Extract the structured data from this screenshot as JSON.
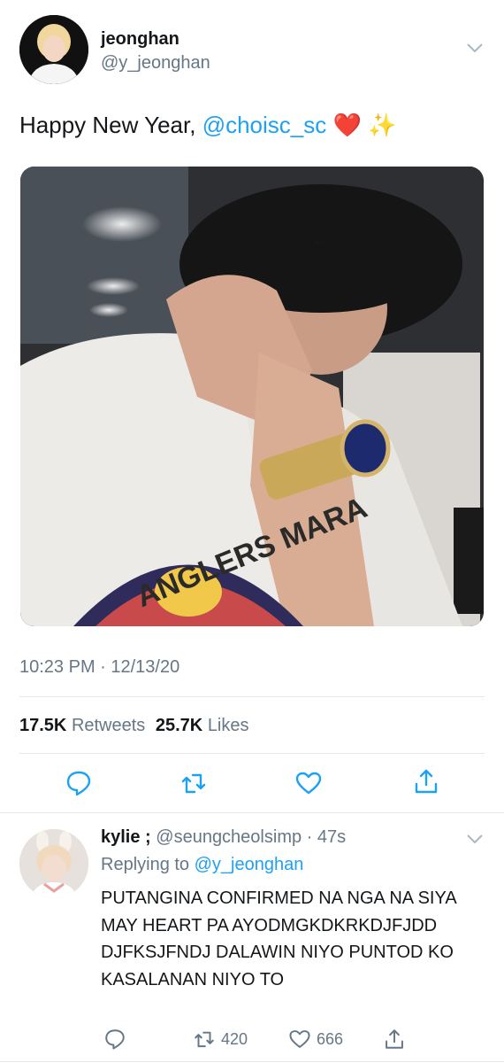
{
  "tweet": {
    "author_name": "jeonghan",
    "author_handle": "@y_jeonghan",
    "text_prefix": "Happy New Year, ",
    "text_mention": "@choisc_sc",
    "text_emoji_heart": "❤️",
    "text_emoji_sparkles": "✨",
    "photo_text": "ANGLERS MARA",
    "timestamp": "10:23 PM · 12/13/20",
    "retweets_count": "17.5K",
    "retweets_label": "Retweets",
    "likes_count": "25.7K",
    "likes_label": "Likes",
    "actions": [
      "reply-icon",
      "retweet-icon",
      "like-icon",
      "share-icon"
    ]
  },
  "reply": {
    "author_name": "kylie ;",
    "author_handle": "@seungcheolsimp",
    "age": "47s",
    "replying_prefix": "Replying to ",
    "replying_mention": "@y_jeonghan",
    "body": "PUTANGINA CONFIRMED NA NGA NA SIYA MAY HEART PA AYODMGKDKRKDJFJDD DJFKSJFNDJ DALAWIN NIYO PUNTOD KO KASALANAN NIYO TO",
    "retweet_count": "420",
    "like_count": "666"
  },
  "colors": {
    "accent": "#1da1f2",
    "muted": "#657786",
    "divider": "#e1e8ed",
    "heart": "#e0245e"
  }
}
